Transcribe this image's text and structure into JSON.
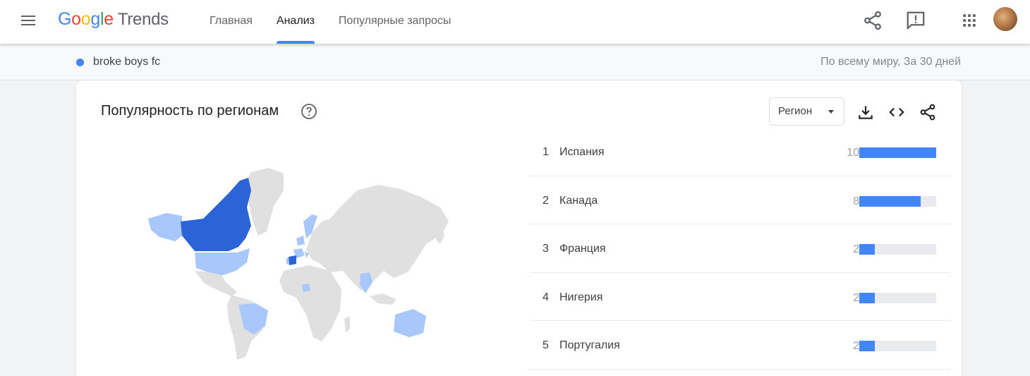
{
  "header": {
    "logo_google": [
      "G",
      "o",
      "o",
      "g",
      "l",
      "e"
    ],
    "logo_product": "Trends",
    "nav": [
      {
        "label": "Главная",
        "active": false
      },
      {
        "label": "Анализ",
        "active": true
      },
      {
        "label": "Популярные запросы",
        "active": false
      }
    ],
    "icons": [
      "share-icon",
      "feedback-icon",
      "apps-grid-icon",
      "avatar"
    ]
  },
  "termbar": {
    "term": "broke boys fc",
    "term_color": "#4285f4",
    "scope": "По всему миру, За 30 дней"
  },
  "card": {
    "title": "Популярность по регионам",
    "region_select": "Регион",
    "icons": [
      "help-icon",
      "download-icon",
      "embed-icon",
      "share-icon"
    ],
    "colors": {
      "high": "#2a64d6",
      "low": "#a8c7fa",
      "none": "#e0e0e0",
      "bar": "#4285f4"
    },
    "regions": [
      {
        "rank": "1",
        "name": "Испания",
        "score": "100",
        "value": 100
      },
      {
        "rank": "2",
        "name": "Канада",
        "score": "80",
        "value": 80
      },
      {
        "rank": "3",
        "name": "Франция",
        "score": "20",
        "value": 20
      },
      {
        "rank": "4",
        "name": "Нигерия",
        "score": "20",
        "value": 20
      },
      {
        "rank": "5",
        "name": "Португалия",
        "score": "20",
        "value": 20
      }
    ]
  }
}
